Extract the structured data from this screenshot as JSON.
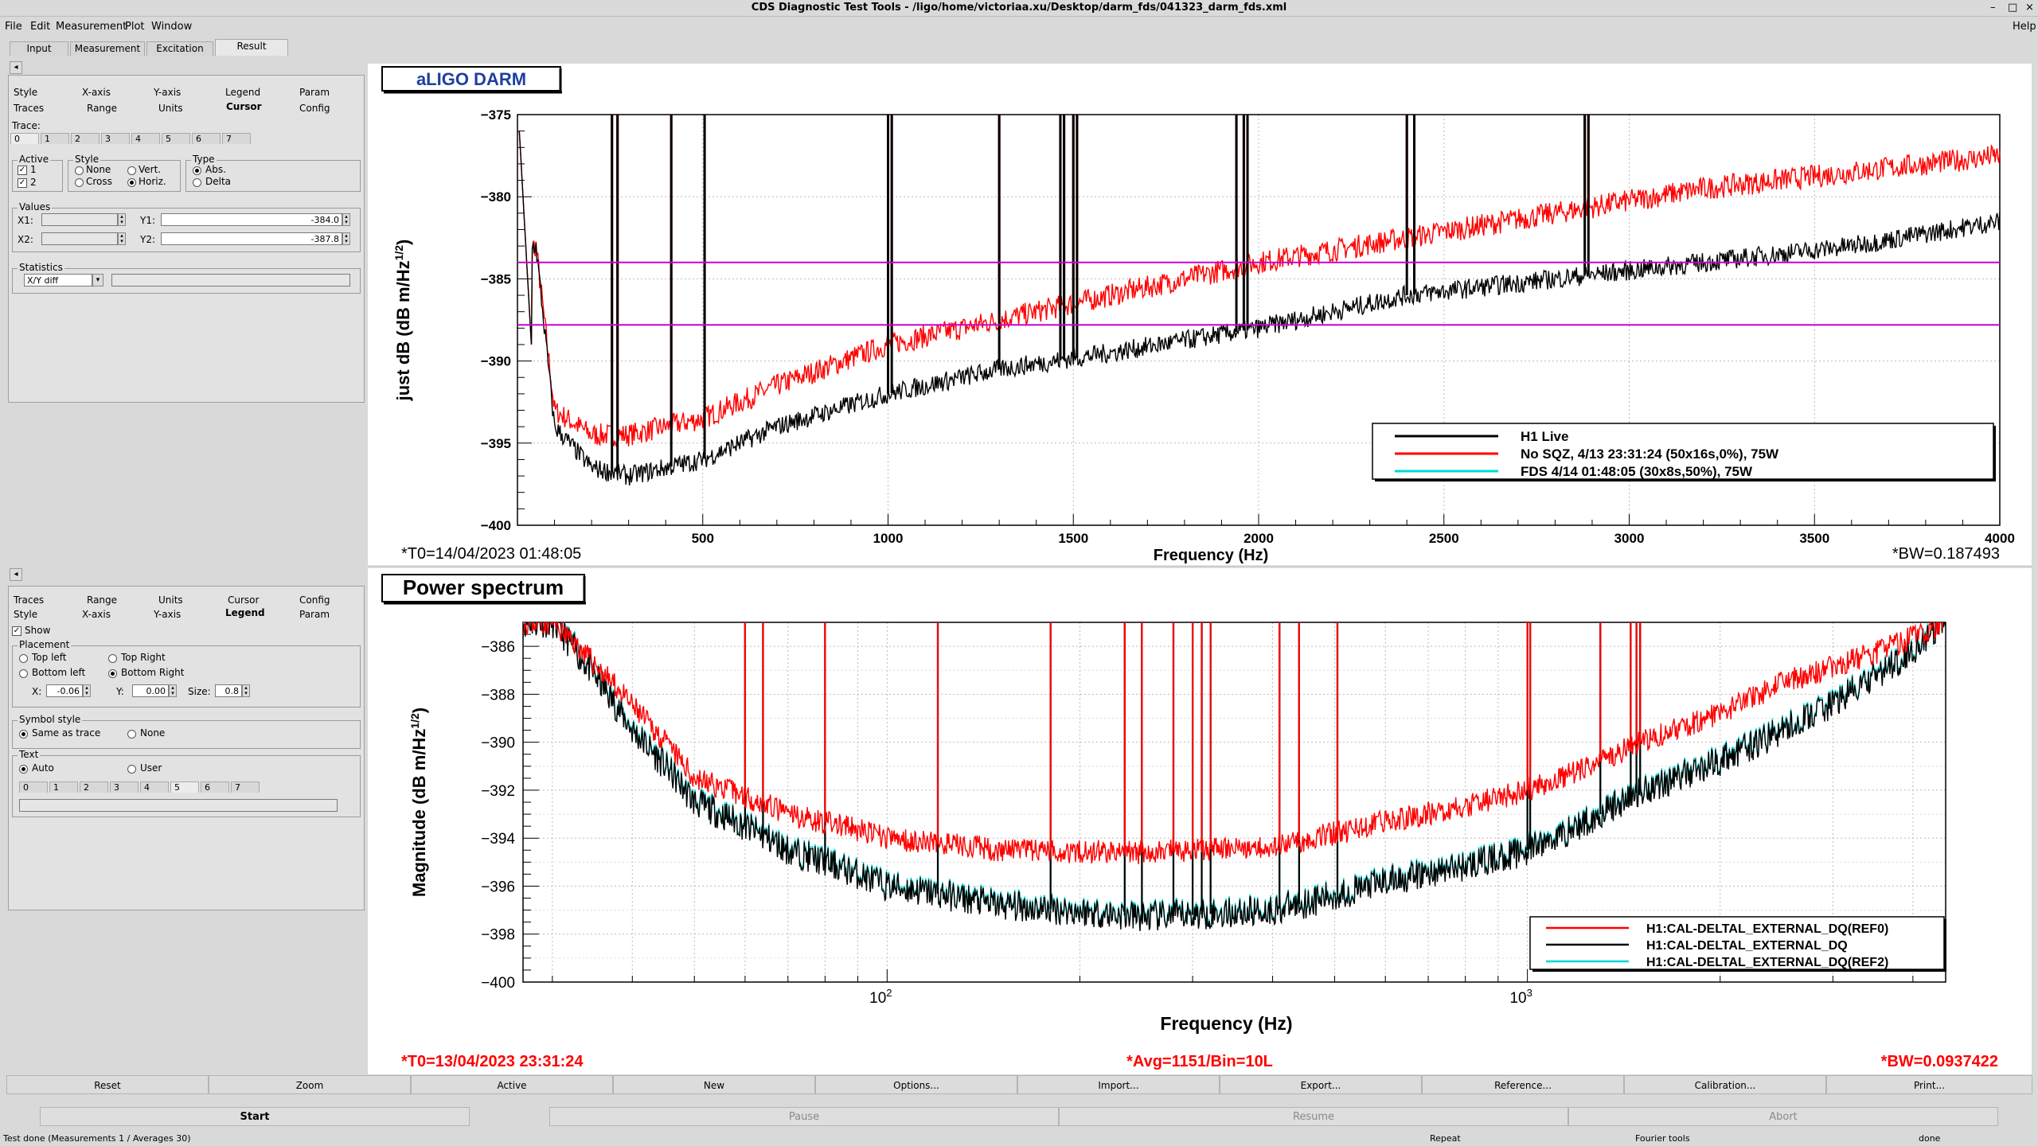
{
  "window": {
    "title": "CDS Diagnostic Test Tools - /ligo/home/victoriaa.xu/Desktop/darm_fds/041323_darm_fds.xml",
    "controls": [
      "–",
      "□",
      "×"
    ]
  },
  "menu": {
    "items": [
      "File",
      "Edit",
      "Measurement",
      "Plot",
      "Window"
    ],
    "help": "Help"
  },
  "main_tabs": [
    "Input",
    "Measurement",
    "Excitation",
    "Result"
  ],
  "top_panel": {
    "collapse_icon": "◂",
    "tabs_row1": [
      "Style",
      "X-axis",
      "Y-axis",
      "Legend",
      "Param"
    ],
    "tabs_row2": [
      "Traces",
      "Range",
      "Units",
      "Cursor",
      "Config"
    ],
    "trace_label": "Trace:",
    "trace_tabs": [
      "0",
      "1",
      "2",
      "3",
      "4",
      "5",
      "6",
      "7"
    ],
    "active_label": "Active",
    "active_items": [
      "1",
      "2"
    ],
    "style_label": "Style",
    "style_opts": [
      "None",
      "Vert.",
      "Cross",
      "Horiz."
    ],
    "type_label": "Type",
    "type_opts": [
      "Abs.",
      "Delta"
    ],
    "values_label": "Values",
    "x1_label": "X1:",
    "x2_label": "X2:",
    "y1_label": "Y1:",
    "y2_label": "Y2:",
    "y1_value": "-384.0",
    "y2_value": "-387.8",
    "statistics_label": "Statistics",
    "statistics_select": "X/Y diff"
  },
  "bottom_panel": {
    "collapse_icon": "◂",
    "tabs_row1": [
      "Traces",
      "Range",
      "Units",
      "Cursor",
      "Config"
    ],
    "tabs_row2": [
      "Style",
      "X-axis",
      "Y-axis",
      "Legend",
      "Param"
    ],
    "show_label": "Show",
    "placement_label": "Placement",
    "placement_opts": [
      "Top left",
      "Top Right",
      "Bottom left",
      "Bottom Right"
    ],
    "x_label": "X:",
    "x_value": "-0.06",
    "y_label": "Y:",
    "y_value": "0.00",
    "size_label": "Size:",
    "size_value": "0.8",
    "symbol_label": "Symbol style",
    "symbol_opts": [
      "Same as trace",
      "None"
    ],
    "text_label": "Text",
    "text_opts": [
      "Auto",
      "User"
    ],
    "text_tabs": [
      "0",
      "1",
      "2",
      "3",
      "4",
      "5",
      "6",
      "7"
    ]
  },
  "buttons_row1": [
    "Reset",
    "Zoom",
    "Active",
    "New",
    "Options...",
    "Import...",
    "Export...",
    "Reference...",
    "Calibration...",
    "Print..."
  ],
  "buttons_row2": [
    "Start",
    "Pause",
    "Resume",
    "Abort"
  ],
  "status_bar": [
    "Test done (Measurements 1 / Averages 30)",
    "Repeat",
    "Fourier tools",
    "done"
  ],
  "colors": {
    "black_trace": "#000000",
    "red_trace": "#ff0000",
    "cyan_trace": "#00d8d8",
    "cursor": "#cc00cc",
    "title_blue": "#1f3f9f"
  },
  "chart_data": [
    {
      "type": "line",
      "title": "aLIGO DARM",
      "xlabel": "Frequency (Hz)",
      "ylabel": "just dB (dB m/Hz^1/2)",
      "xlim": [
        0,
        4000
      ],
      "ylim": [
        -400,
        -375
      ],
      "xticks": [
        500,
        1000,
        1500,
        2000,
        2500,
        3000,
        3500,
        4000
      ],
      "yticks": [
        -375,
        -380,
        -385,
        -390,
        -395,
        -400
      ],
      "grid": true,
      "legend_position": "bottom-right",
      "cursor_lines_y": [
        -384.0,
        -387.8
      ],
      "footer_left": "*T0=14/04/2023 01:48:05",
      "footer_right": "*BW=0.187493",
      "lines_hz": [
        255,
        270,
        415,
        505,
        1000,
        1010,
        1300,
        1465,
        1475,
        1500,
        1510,
        1940,
        1960,
        1970,
        2400,
        2420,
        2880,
        2890
      ],
      "series": [
        {
          "name": "H1 Live",
          "color": "#000000",
          "x": [
            50,
            100,
            200,
            300,
            500,
            700,
            1000,
            1300,
            1600,
            2000,
            2400,
            2800,
            3200,
            3600,
            4000
          ],
          "y": [
            -383,
            -394,
            -396.5,
            -397,
            -396,
            -394,
            -392,
            -390.5,
            -389.5,
            -388,
            -386,
            -385,
            -384,
            -383,
            -381.5
          ]
        },
        {
          "name": "No SQZ, 4/13 23:31:24 (50x16s,0%), 75W",
          "color": "#ff0000",
          "x": [
            50,
            100,
            200,
            300,
            500,
            700,
            1000,
            1300,
            1600,
            2000,
            2400,
            2800,
            3200,
            3600,
            4000
          ],
          "y": [
            -383,
            -393,
            -394.5,
            -394.5,
            -393.5,
            -391.5,
            -389,
            -387.5,
            -386,
            -384,
            -382.5,
            -381,
            -379.5,
            -378.5,
            -377.5
          ]
        },
        {
          "name": "FDS 4/14 01:48:05 (30x8s,50%), 75W",
          "color": "#00d8d8",
          "x": [],
          "y": []
        }
      ]
    },
    {
      "type": "line",
      "title": "Power spectrum",
      "xlabel": "Frequency (Hz)",
      "ylabel": "Magnitude (dB m/Hz^1/2)",
      "xscale": "log",
      "xlim": [
        27,
        4500
      ],
      "ylim": [
        -400,
        -385
      ],
      "yticks": [
        -386,
        -388,
        -390,
        -392,
        -394,
        -396,
        -398,
        -400
      ],
      "xtick_labels": [
        "10^2",
        "10^3"
      ],
      "grid": true,
      "legend_position": "bottom-right",
      "footer_left": "*T0=13/04/2023 23:31:24",
      "footer_center": "*Avg=1151/Bin=10L",
      "footer_right": "*BW=0.0937422",
      "lines_hz": [
        60,
        64,
        80,
        120,
        180,
        235,
        250,
        280,
        300,
        310,
        320,
        410,
        440,
        505,
        1000,
        1010,
        1300,
        1450,
        1480,
        1500
      ],
      "series": [
        {
          "name": "H1:CAL-DELTAL_EXTERNAL_DQ(REF0)",
          "color": "#ff0000",
          "x": [
            30,
            40,
            50,
            70,
            100,
            150,
            250,
            400,
            600,
            1000,
            1500,
            2500,
            4500
          ],
          "y": [
            -385,
            -388.5,
            -391.5,
            -393,
            -394,
            -394.5,
            -394.6,
            -394.3,
            -393.3,
            -392,
            -390,
            -387.5,
            -385
          ]
        },
        {
          "name": "H1:CAL-DELTAL_EXTERNAL_DQ",
          "color": "#000000",
          "x": [
            30,
            40,
            50,
            70,
            100,
            150,
            250,
            400,
            600,
            1000,
            1500,
            2500,
            4500
          ],
          "y": [
            -385,
            -389.5,
            -392.5,
            -394.5,
            -396,
            -396.8,
            -397.3,
            -397,
            -395.8,
            -394.5,
            -392,
            -389.5,
            -385
          ]
        },
        {
          "name": "H1:CAL-DELTAL_EXTERNAL_DQ(REF2)",
          "color": "#00d8d8",
          "x": [
            30,
            40,
            50,
            70,
            100,
            150,
            250,
            400,
            600,
            1000,
            1500,
            2500,
            4500
          ],
          "y": [
            -385,
            -389.5,
            -392.5,
            -394.5,
            -396,
            -396.8,
            -397.3,
            -397,
            -395.8,
            -394.5,
            -392,
            -389.5,
            -385
          ]
        }
      ]
    }
  ]
}
